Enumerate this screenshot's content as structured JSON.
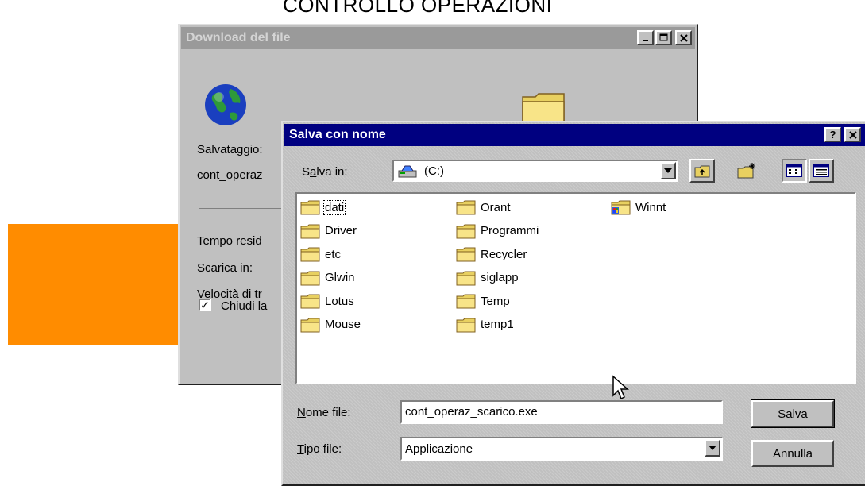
{
  "slide": {
    "title": "CONTROLLO OPERAZIONI",
    "accent_color": "#ff8c00"
  },
  "download_dialog": {
    "title": "Download del file",
    "window_buttons": [
      "minimize",
      "maximize",
      "close"
    ],
    "icons": [
      "globe-icon",
      "folder-icon"
    ],
    "saving_label": "Salvataggio:",
    "filename_label": "cont_operaz",
    "progress": 0,
    "time_label": "Tempo resid",
    "download_to_label": "Scarica in:",
    "speed_label": "Velocità di tr",
    "close_checkbox": {
      "checked": true,
      "label": "Chiudi la"
    }
  },
  "save_dialog": {
    "title": "Salva con nome",
    "title_buttons": [
      "?",
      "X"
    ],
    "save_in_label": "Salva in:",
    "save_in_label_accel": "a",
    "save_in_value": "(C:)",
    "toolbar_icons": [
      "up-folder-icon",
      "new-folder-icon",
      "list-view-icon",
      "details-view-icon"
    ],
    "files": [
      {
        "name": "dati",
        "icon": "folder-icon",
        "focused": true
      },
      {
        "name": "Driver",
        "icon": "folder-icon"
      },
      {
        "name": "etc",
        "icon": "folder-icon"
      },
      {
        "name": "Glwin",
        "icon": "folder-icon"
      },
      {
        "name": "Lotus",
        "icon": "folder-icon"
      },
      {
        "name": "Mouse",
        "icon": "folder-icon"
      },
      {
        "name": "Orant",
        "icon": "folder-icon"
      },
      {
        "name": "Programmi",
        "icon": "folder-icon"
      },
      {
        "name": "Recycler",
        "icon": "folder-icon"
      },
      {
        "name": "siglapp",
        "icon": "folder-icon"
      },
      {
        "name": "Temp",
        "icon": "folder-icon"
      },
      {
        "name": "temp1",
        "icon": "folder-icon"
      },
      {
        "name": "Winnt",
        "icon": "windows-folder-icon"
      }
    ],
    "filename_label": "Nome file:",
    "filename_value": "cont_operaz_scarico.exe",
    "filetype_label": "Tipo file:",
    "filetype_value": "Applicazione",
    "save_button": "Salva",
    "cancel_button": "Annulla"
  }
}
